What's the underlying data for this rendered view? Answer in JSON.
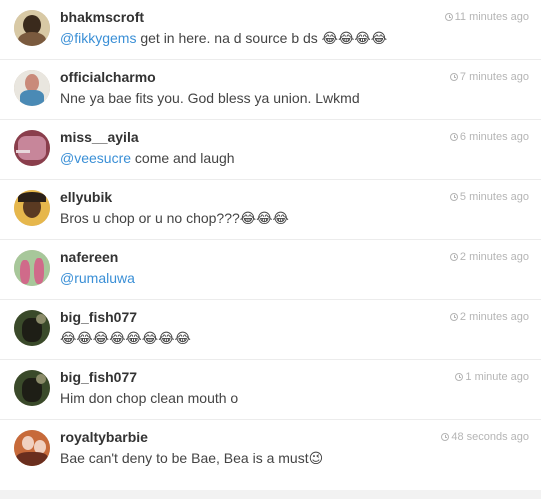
{
  "comments": [
    {
      "username": "bhakmscroft",
      "mention": "@fikkygems",
      "text": " get in here. na d source b ds 😂😂😂😂",
      "time": "11 minutes ago",
      "avatar_colors": [
        "#d8c9a5",
        "#3a2a1c",
        "#7a5a3e"
      ]
    },
    {
      "username": "officialcharmo",
      "mention": "",
      "text": "Nne ya bae fits you. God bless ya union. Lwkmd",
      "time": "7 minutes ago",
      "avatar_colors": [
        "#e9e6df",
        "#c98a7a",
        "#4a8ab5"
      ]
    },
    {
      "username": "miss__ayila",
      "mention": "@veesucre",
      "text": " come and laugh",
      "time": "6 minutes ago",
      "avatar_colors": [
        "#8a3e4c",
        "#c7869a",
        "#e8d8dc"
      ]
    },
    {
      "username": "ellyubik",
      "mention": "",
      "text": "Bros u chop or u no chop???😂😂😂",
      "time": "5 minutes ago",
      "avatar_colors": [
        "#e6b74c",
        "#5a3a22",
        "#2b2018"
      ]
    },
    {
      "username": "nafereen",
      "mention": "@rumaluwa",
      "text": "",
      "time": "2 minutes ago",
      "avatar_colors": [
        "#a7c79a",
        "#d06a8a",
        "#5a3a2a"
      ]
    },
    {
      "username": "big_fish077",
      "mention": "",
      "text": "😂😂😂😂😂😂😂😂",
      "time": "2 minutes ago",
      "avatar_colors": [
        "#3a4a2a",
        "#1e1e16",
        "#8c8c6a"
      ]
    },
    {
      "username": "big_fish077",
      "mention": "",
      "text": "Him don chop clean mouth o",
      "time": "1 minute ago",
      "avatar_colors": [
        "#3a4a2a",
        "#1e1e16",
        "#8c8c6a"
      ]
    },
    {
      "username": "royaltybarbie",
      "mention": "",
      "text": "Bae can't deny to be Bae, Bea is a must😉",
      "time": "48 seconds ago",
      "avatar_colors": [
        "#c76a3a",
        "#f0d0c0",
        "#6a2e1e"
      ]
    }
  ]
}
